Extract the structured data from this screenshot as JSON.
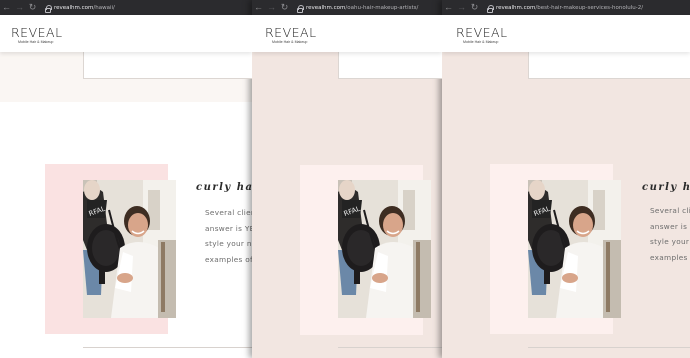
{
  "colors": {
    "browser_bar": "#2b2b2e",
    "pink_block": "#fae2e2",
    "blush_background": "#f2e6e1",
    "body_text": "#6c6c6c"
  },
  "icons": {
    "back": "arrow-left-icon",
    "forward": "arrow-right-icon",
    "reload": "reload-icon",
    "secure": "lock-icon"
  },
  "browser": {
    "back_glyph": "←",
    "forward_glyph": "→",
    "reload_glyph": "↻"
  },
  "brand": {
    "logo": "REVEAL",
    "tagline": "Mobile Hair & Makeup"
  },
  "windows": [
    {
      "url_host": "revealhm.com",
      "url_path": "/hawaii/",
      "section_title": "curly hai",
      "paragraph_lines": [
        "Several clien",
        "answer is YE",
        "style your na",
        "examples of"
      ]
    },
    {
      "url_host": "revealhm.com",
      "url_path": "/oahu-hair-makeup-artists/",
      "section_title": "",
      "paragraph_lines": []
    },
    {
      "url_host": "revealhm.com",
      "url_path": "/best-hair-makeup-services-honolulu-2/",
      "section_title": "curly ha",
      "paragraph_lines": [
        "Several cli",
        "answer is Y",
        "style your n",
        "examples o"
      ]
    }
  ]
}
